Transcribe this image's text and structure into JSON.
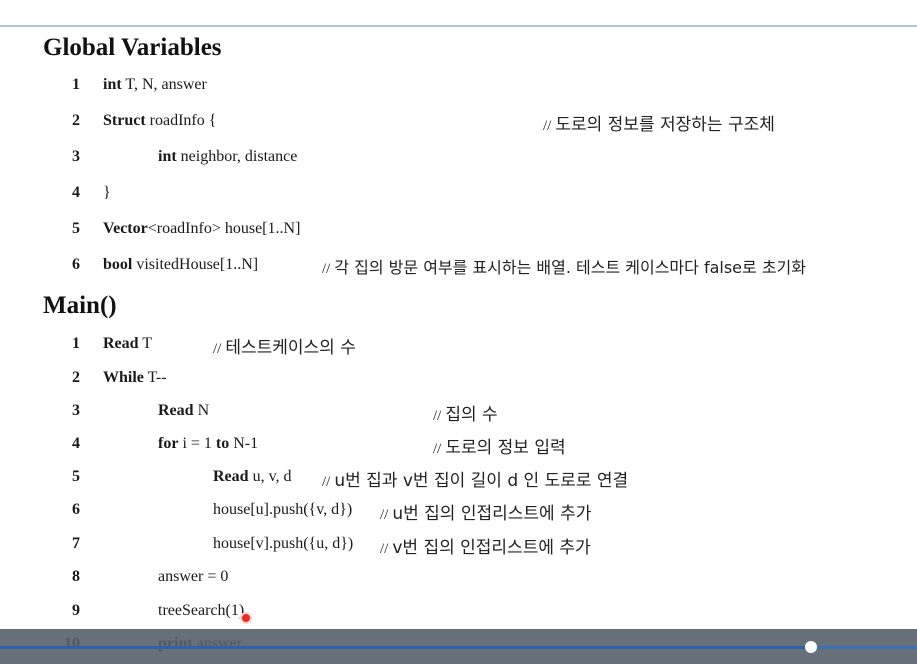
{
  "global": {
    "heading": "Global  Variables",
    "lines": [
      {
        "n": "1",
        "kw": "int",
        "rest": " T, N, answer",
        "comment": ""
      },
      {
        "n": "2",
        "kw": "Struct",
        "rest": " roadInfo {",
        "comment": "도로의 정보를 저장하는 구조체"
      },
      {
        "n": "3",
        "kw": "int",
        "rest": " neighbor, distance",
        "comment": ""
      },
      {
        "n": "4",
        "kw": "",
        "rest": "}",
        "comment": ""
      },
      {
        "n": "5",
        "kw": "Vector",
        "rest": "<roadInfo>  house[1..N]",
        "comment": ""
      },
      {
        "n": "6",
        "kw": "bool",
        "rest": " visitedHouse[1..N]",
        "comment": "각 집의 방문 여부를 표시하는 배열. 테스트 케이스마다 false로 초기화"
      }
    ]
  },
  "main": {
    "heading": "Main()",
    "lines": [
      {
        "n": "1",
        "kw": "Read",
        "rest": " T",
        "comment": "테스트케이스의 수"
      },
      {
        "n": "2",
        "kw": "While",
        "rest": " T--",
        "comment": ""
      },
      {
        "n": "3",
        "kw": "Read",
        "rest": " N",
        "comment": "집의 수"
      },
      {
        "n": "4",
        "kw": "for",
        "rest": " i = 1  ",
        "kw2": "to",
        "rest2": "  N-1",
        "comment": "도로의 정보 입력"
      },
      {
        "n": "5",
        "kw": "Read",
        "rest": " u, v, d",
        "comment": "u번 집과 v번 집이 길이 d 인 도로로 연결"
      },
      {
        "n": "6",
        "kw": "",
        "rest": "house[u].push({v, d})",
        "comment": "u번 집의 인접리스트에 추가"
      },
      {
        "n": "7",
        "kw": "",
        "rest": "house[v].push({u, d})",
        "comment": "v번 집의 인접리스트에 추가"
      },
      {
        "n": "8",
        "kw": "",
        "rest": "answer = 0",
        "comment": ""
      },
      {
        "n": "9",
        "kw": "",
        "rest": "treeSearch(1)",
        "comment": ""
      },
      {
        "n": "10",
        "kw": "print",
        "rest": " answer",
        "comment": ""
      }
    ]
  },
  "comment_prefix": "//",
  "player": {
    "progress_fraction": 0.884
  },
  "colors": {
    "rule": "#a9c7df",
    "cursor": "#e0302c",
    "player_bg": "#46505c",
    "progress": "#2b62a8"
  }
}
